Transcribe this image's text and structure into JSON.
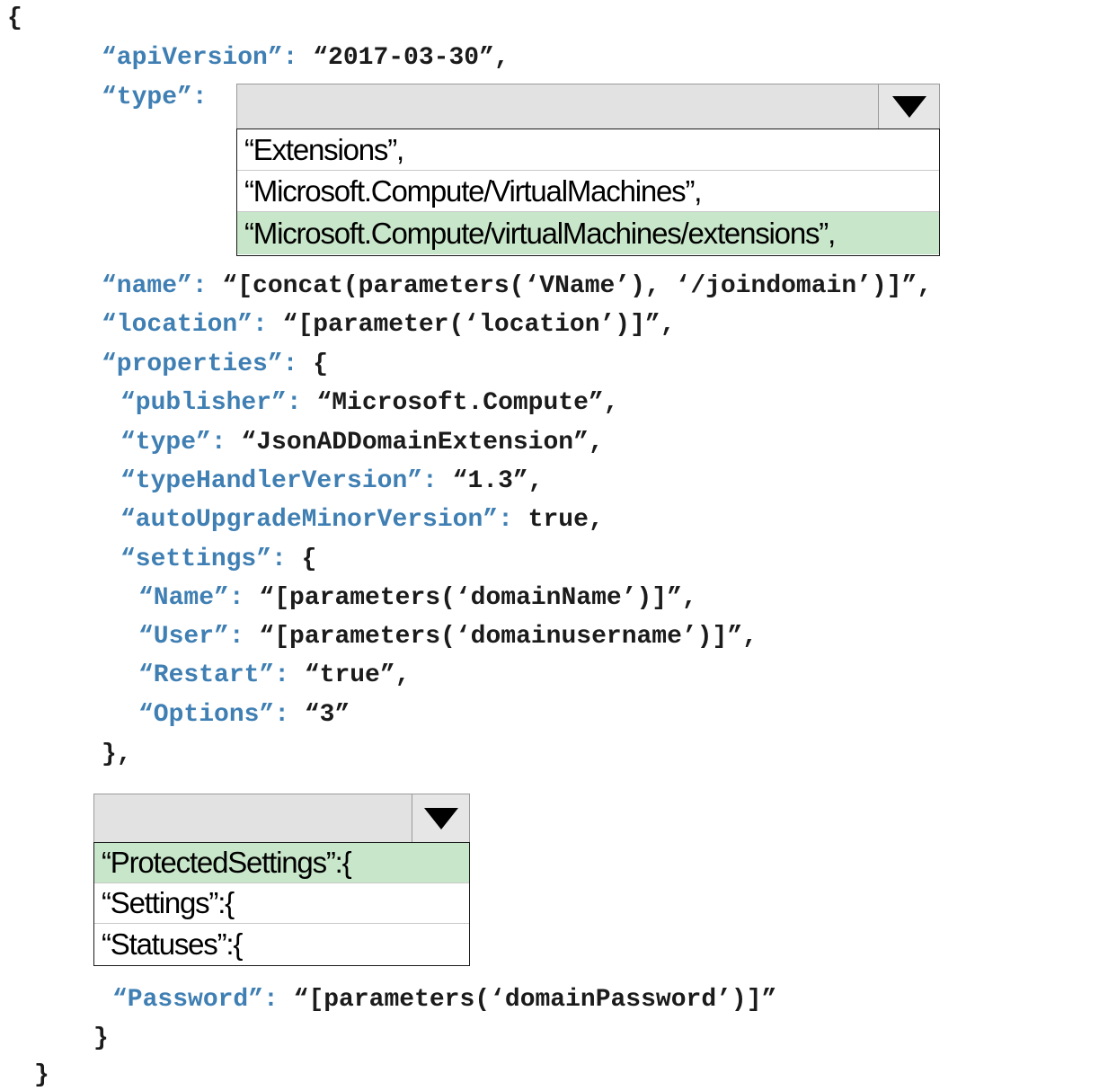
{
  "code": {
    "open_brace": "{",
    "apiVersion_key": "“apiVersion”:",
    "apiVersion_val": " “2017-03-30”,",
    "type_key": "“type”:",
    "name_key": "“name”:",
    "name_val": " “[concat(parameters(‘VName’), ‘/joindomain’)]”,",
    "location_key": "“location”:",
    "location_val": " “[parameter(‘location’)]”,",
    "properties_key": "“properties”:",
    "properties_val": " {",
    "publisher_key": "“publisher”:",
    "publisher_val": " “Microsoft.Compute”,",
    "ptype_key": "“type”:",
    "ptype_val": " “JsonADDomainExtension”,",
    "thv_key": "“typeHandlerVersion”:",
    "thv_val": " “1.3”,",
    "aumv_key": "“autoUpgradeMinorVersion”:",
    "aumv_val": " true,",
    "settings_key": "“settings”:",
    "settings_val": " {",
    "sname_key": "“Name”:",
    "sname_val": " “[parameters(‘domainName’)]”,",
    "suser_key": "“User”:",
    "suser_val": " “[parameters(‘domainusername’)]”,",
    "srestart_key": "“Restart”:",
    "srestart_val": " “true”,",
    "soptions_key": "“Options”:",
    "soptions_val": " “3”",
    "settings_close": "},",
    "password_key": "“Password”:",
    "password_val": " “[parameters(‘domainPassword’)]”",
    "inner_close": "}",
    "outer_close": "}"
  },
  "type_dropdown": {
    "options": [
      "“Extensions”,",
      "“Microsoft.Compute/VirtualMachines”,",
      "“Microsoft.Compute/virtualMachines/extensions”,"
    ],
    "selected_index": 2
  },
  "settings_dropdown": {
    "options": [
      "“ProtectedSettings”:{",
      "“Settings”:{",
      "“Statuses”:{"
    ],
    "selected_index": 0
  },
  "colors": {
    "key": "#3f7fb3",
    "value": "#1b1b1b",
    "selected_option": "#c8e6c9",
    "dropdown_bg": "#e2e2e2"
  },
  "icons": {
    "dropdown_arrow": "triangle-down-icon"
  }
}
